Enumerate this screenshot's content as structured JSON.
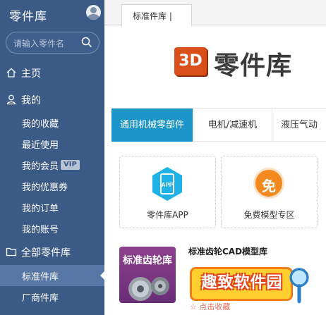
{
  "sidebar": {
    "brand": "零件库",
    "search_placeholder": "请输入零件名",
    "items": [
      {
        "label": "主页",
        "icon": "home-icon"
      },
      {
        "label": "我的",
        "icon": "user-icon"
      },
      {
        "label": "我的收藏"
      },
      {
        "label": "最近使用"
      },
      {
        "label": "我的会员",
        "badge": "VIP"
      },
      {
        "label": "我的优惠券"
      },
      {
        "label": "我的订单"
      },
      {
        "label": "我的账号"
      },
      {
        "label": "全部零件库",
        "icon": "folder-icon"
      },
      {
        "label": "标准件库",
        "active": true
      },
      {
        "label": "厂商件库"
      }
    ]
  },
  "tab": {
    "label": "标准件库 |"
  },
  "logo": {
    "mark": "3D",
    "text": "零件库"
  },
  "categories": [
    "通用机械零部件",
    "电机/减速机",
    "液压气动"
  ],
  "cards": [
    {
      "label": "零件库APP",
      "icon_text": "APP",
      "icon": "app-icon"
    },
    {
      "label": "免费模型专区",
      "icon_text": "免",
      "icon": "free-icon"
    }
  ],
  "listing": {
    "thumb_title": "标准齿轮库",
    "title": "标准齿轮CAD模型库",
    "favorite": "☆ 点击收藏"
  },
  "watermark": {
    "text": "趣致软件园"
  },
  "colors": {
    "sidebar": "#3c5a86",
    "active_category": "#1b95c8",
    "logo_accent": "#d94f1c"
  }
}
